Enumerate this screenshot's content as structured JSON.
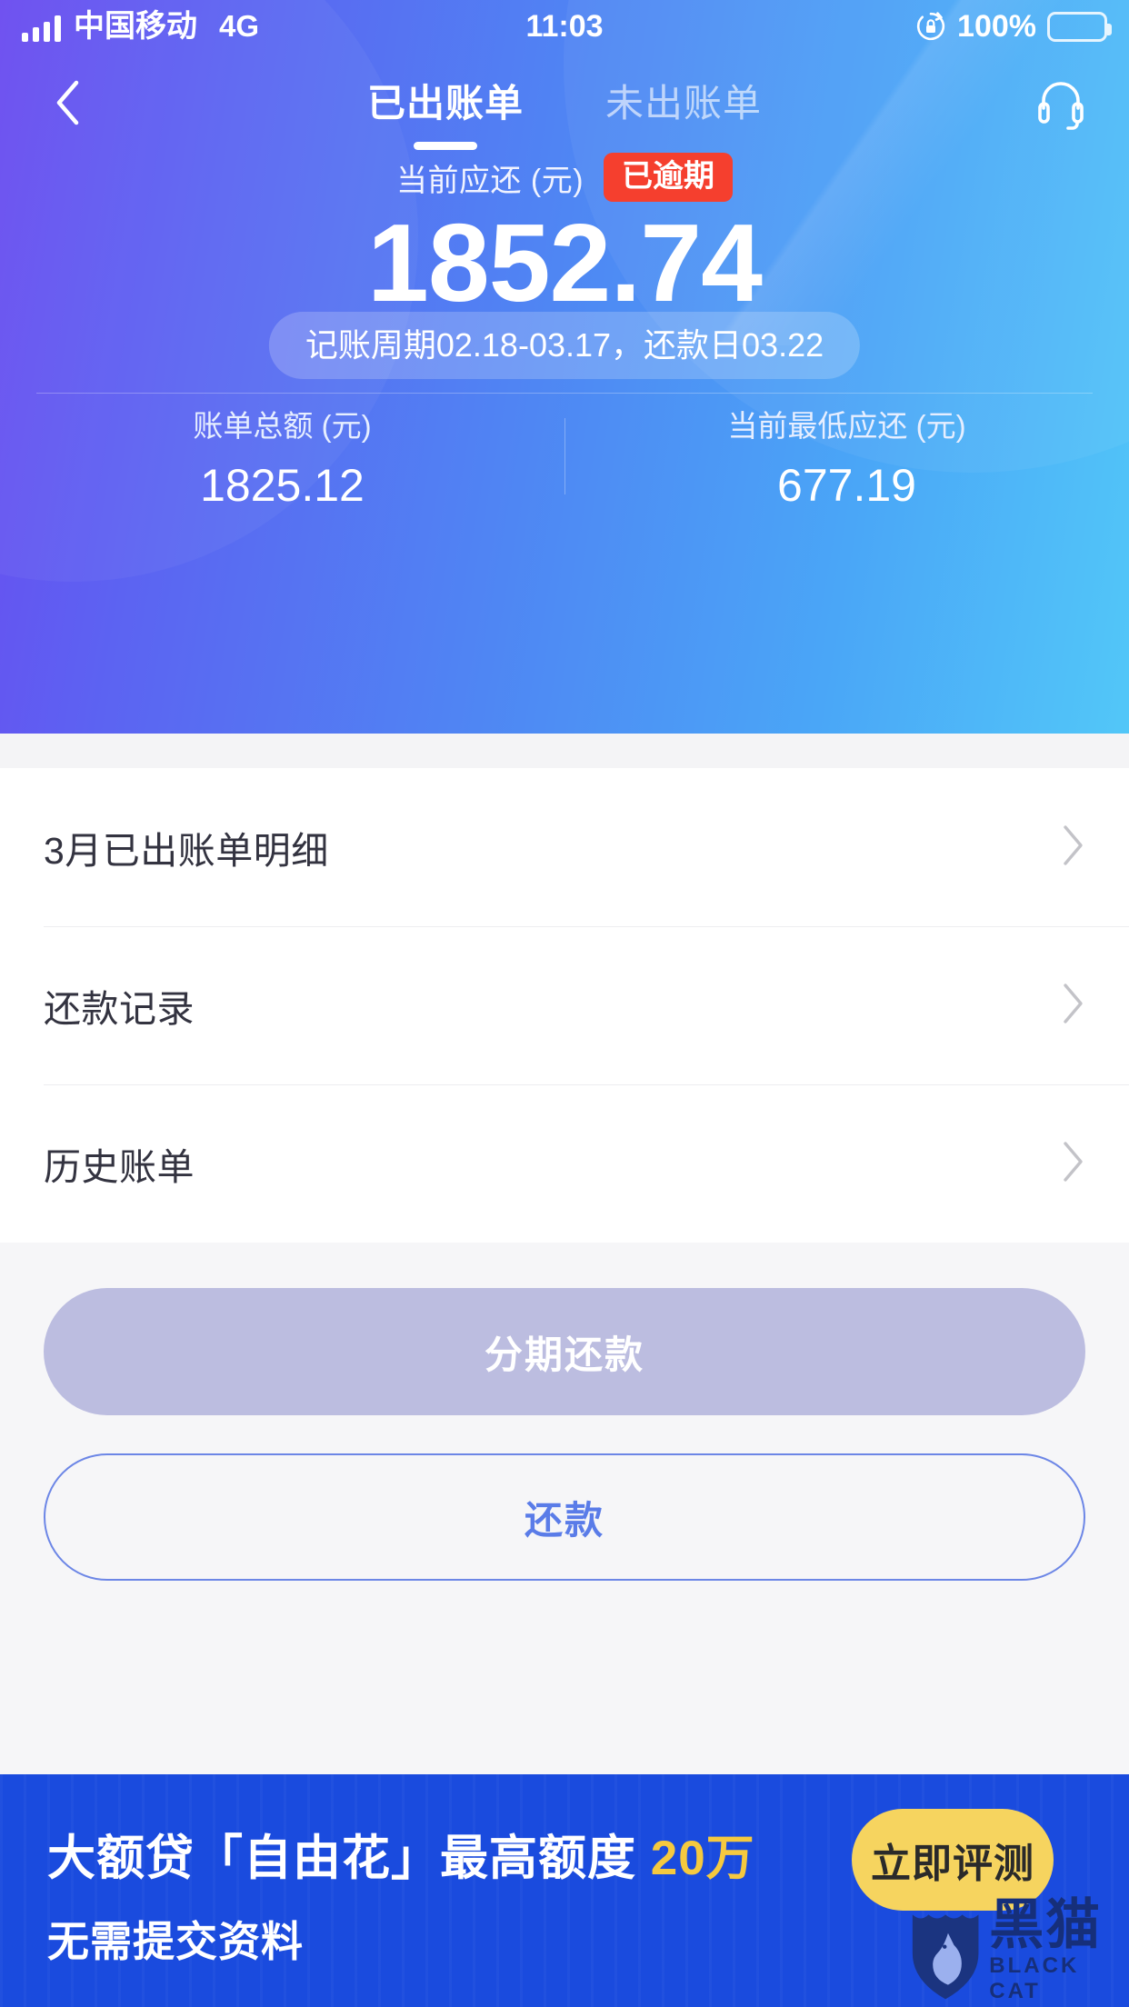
{
  "status_bar": {
    "carrier": "中国移动",
    "network": "4G",
    "time": "11:03",
    "battery_percent": "100%",
    "signal_icon": "signal-bars-icon",
    "rotation_lock_icon": "rotation-lock-icon",
    "battery_icon": "battery-full-icon"
  },
  "nav": {
    "back_icon": "back-chevron-icon",
    "service_icon": "headset-icon",
    "tabs": [
      {
        "label": "已出账单",
        "active": true
      },
      {
        "label": "未出账单",
        "active": false
      }
    ]
  },
  "summary": {
    "due_label": "当前应还 (元)",
    "overdue_badge": "已逾期",
    "due_amount": "1852.74",
    "cycle_text": "记账周期02.18-03.17，还款日03.22",
    "stats": [
      {
        "label": "账单总额 (元)",
        "value": "1825.12"
      },
      {
        "label": "当前最低应还 (元)",
        "value": "677.19"
      }
    ]
  },
  "menu": {
    "items": [
      {
        "label": "3月已出账单明细",
        "chevron_icon": "chevron-right-icon"
      },
      {
        "label": "还款记录",
        "chevron_icon": "chevron-right-icon"
      },
      {
        "label": "历史账单",
        "chevron_icon": "chevron-right-icon"
      }
    ]
  },
  "actions": {
    "installment_label": "分期还款",
    "repay_label": "还款"
  },
  "ad": {
    "line1_prefix": "大额贷「自由花」最高额度 ",
    "line1_highlight": "20万",
    "line2": "无需提交资料",
    "cta_label": "立即评测",
    "watermark_cn": "黑猫",
    "watermark_en": "BLACK CAT"
  },
  "colors": {
    "overdue_red": "#f53f2e",
    "ad_blue": "#1a4bde",
    "ad_yellow": "#f6d45f",
    "repay_blue": "#5a7ce8",
    "installment_disabled": "#bcbde0"
  }
}
